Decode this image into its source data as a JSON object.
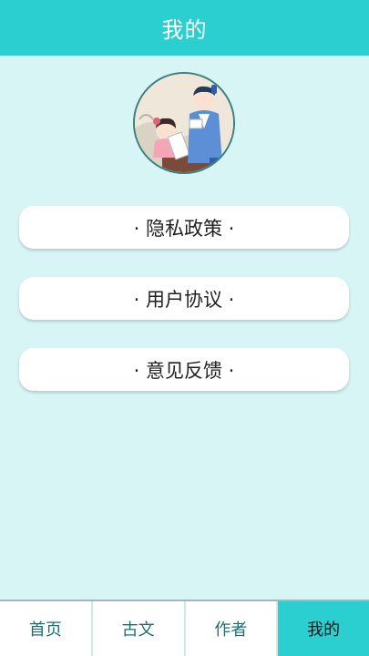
{
  "header": {
    "title": "我的"
  },
  "profile": {
    "avatar_icon": "scholars-illustration-avatar"
  },
  "menu": {
    "items": [
      {
        "label": "· 隐私政策 ·"
      },
      {
        "label": "· 用户协议 ·"
      },
      {
        "label": "· 意见反馈 ·"
      }
    ]
  },
  "tabbar": {
    "tabs": [
      {
        "label": "首页",
        "active": false
      },
      {
        "label": "古文",
        "active": false
      },
      {
        "label": "作者",
        "active": false
      },
      {
        "label": "我的",
        "active": true
      }
    ]
  },
  "colors": {
    "accent": "#2ccfcf",
    "background": "#d8f5f5"
  }
}
